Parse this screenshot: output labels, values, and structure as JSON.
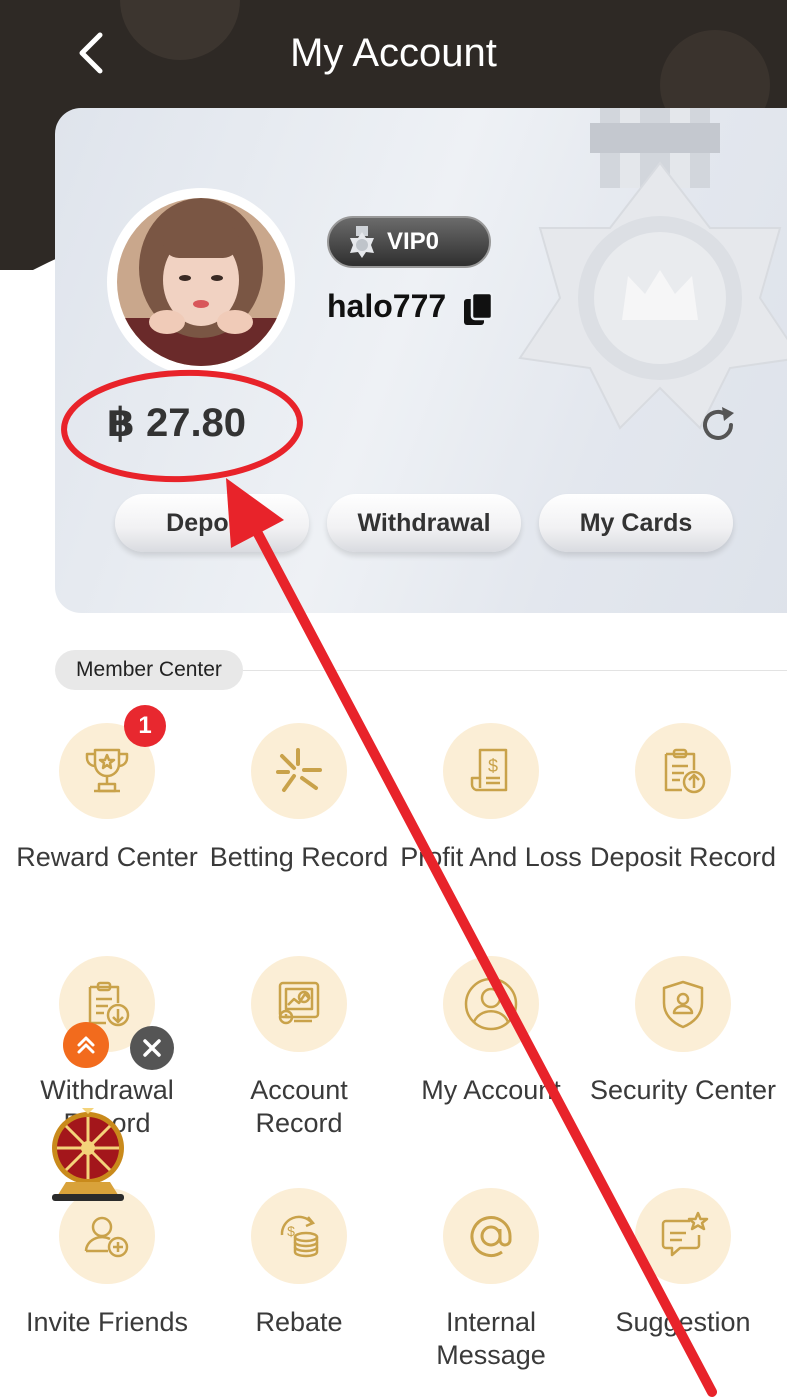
{
  "header": {
    "title": "My Account"
  },
  "account": {
    "vip_level": "VIP0",
    "username": "halo777",
    "balance": "฿ 27.80"
  },
  "actions": {
    "deposit": "Deposit",
    "withdrawal": "Withdrawal",
    "my_cards": "My Cards"
  },
  "member_center": {
    "title": "Member Center",
    "reward_badge": "1",
    "items": [
      {
        "label": "Reward Center",
        "icon": "trophy-icon"
      },
      {
        "label": "Betting Record",
        "icon": "betting-icon"
      },
      {
        "label": "Profit And Loss",
        "icon": "receipt-icon"
      },
      {
        "label": "Deposit Record",
        "icon": "deposit-record-icon"
      },
      {
        "label": "Withdrawal Record",
        "icon": "withdrawal-record-icon"
      },
      {
        "label": "Account Record",
        "icon": "account-record-icon"
      },
      {
        "label": "My Account",
        "icon": "user-icon"
      },
      {
        "label": "Security Center",
        "icon": "shield-icon"
      },
      {
        "label": "Invite Friends",
        "icon": "invite-icon"
      },
      {
        "label": "Rebate",
        "icon": "coins-icon"
      },
      {
        "label": "Internal Message",
        "icon": "at-icon"
      },
      {
        "label": "Suggestion",
        "icon": "suggestion-icon"
      }
    ]
  },
  "colors": {
    "header": "#2e2925",
    "icon_bg": "#fbeed6",
    "icon_stroke": "#c9a24a",
    "badge": "#e8282f",
    "annotation": "#e8232a"
  }
}
